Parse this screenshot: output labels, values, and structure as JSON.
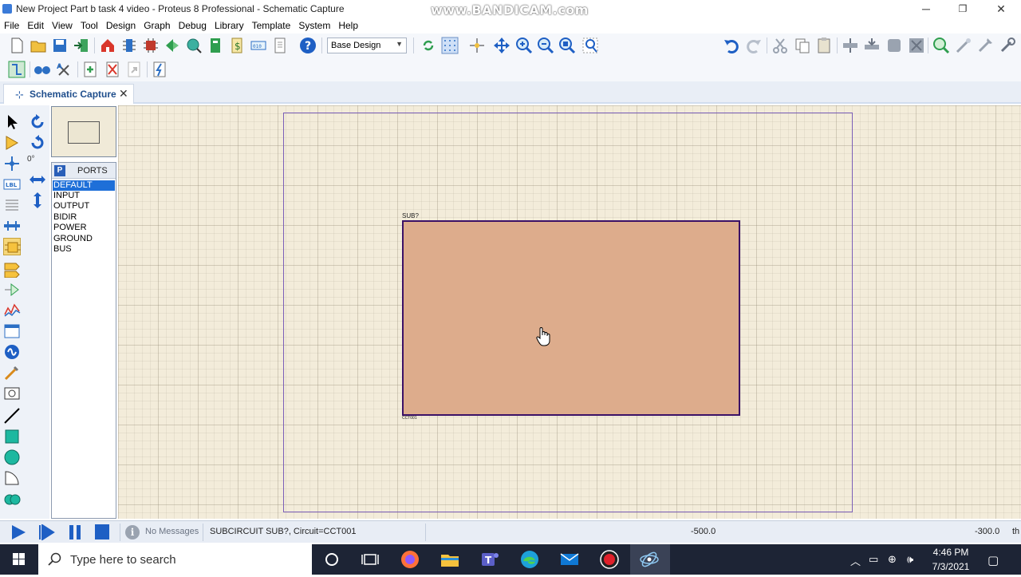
{
  "window": {
    "title": "New Project Part b task 4 video - Proteus 8 Professional - Schematic Capture",
    "watermark": "www.BANDICAM.com",
    "minimize": "─",
    "maximize": "❐",
    "close": "✕"
  },
  "menu": [
    "File",
    "Edit",
    "View",
    "Tool",
    "Design",
    "Graph",
    "Debug",
    "Library",
    "Template",
    "System",
    "Help"
  ],
  "toolbar": {
    "design_select_value": "Base Design"
  },
  "tabs": [
    {
      "label": "Schematic Capture",
      "close": "✕"
    }
  ],
  "palette": {
    "rotation_angle": "0°"
  },
  "ports_panel": {
    "mode_button": "P",
    "title": "PORTS",
    "items": [
      "DEFAULT",
      "INPUT",
      "OUTPUT",
      "BIDIR",
      "POWER",
      "GROUND",
      "BUS"
    ],
    "selected_index": 0
  },
  "canvas": {
    "component_ref": "SUB?",
    "circuit_name": "CCT001",
    "component_color": "#ddac8c",
    "component_border": "#3b1166"
  },
  "statusbar": {
    "messages": "No Messages",
    "status": "SUBCIRCUIT SUB?, Circuit=CCT001",
    "x_coord": "-500.0",
    "y_coord": "-300.0",
    "unit": "th"
  },
  "taskbar": {
    "search_placeholder": "Type here to search",
    "time": "4:46 PM",
    "date": "7/3/2021",
    "apps": [
      "cortana-icon",
      "task-view-icon",
      "firefox-icon",
      "file-explorer-icon",
      "teams-icon",
      "edge-icon",
      "mail-icon",
      "bandicam-record-icon",
      "proteus-icon"
    ]
  },
  "colors": {
    "canvas_bg": "#f3ecda",
    "sheet_border": "#7b5fb8",
    "selected_port_bg": "#1e6fd8"
  }
}
